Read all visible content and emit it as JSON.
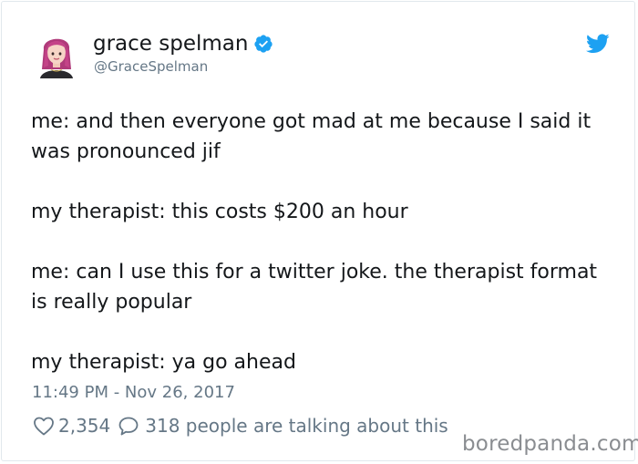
{
  "user": {
    "display_name": "grace spelman",
    "handle": "@GraceSpelman"
  },
  "icons": {
    "avatar": "avatar",
    "verified": "verified-badge-icon",
    "brand": "twitter-bird-icon",
    "like": "heart-icon",
    "reply": "speech-bubble-icon"
  },
  "colors": {
    "brand": "#1da1f2",
    "text": "#14171a",
    "secondary": "#657786"
  },
  "tweet": {
    "paragraphs": [
      "me: and then everyone got mad at me because I said it was pronounced jif",
      "my therapist: this costs $200 an hour",
      "me: can I use this for a twitter joke. the therapist format is really popular",
      "my therapist: ya go ahead"
    ],
    "timestamp": "11:49 PM - Nov 26, 2017",
    "like_count": "2,354",
    "talking_text": "318 people are talking about this"
  },
  "watermark": "boredpanda.com"
}
